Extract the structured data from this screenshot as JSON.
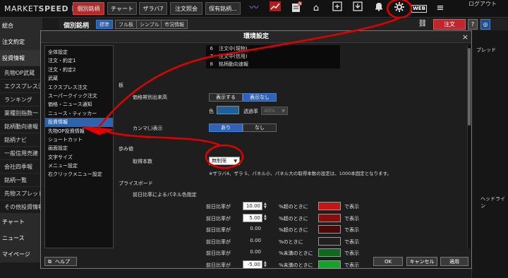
{
  "app": {
    "logo_left": "MARKET",
    "logo_right": "SPEED II",
    "logout_label": "ログアウト"
  },
  "topbar": {
    "buttons": [
      "個別銘柄",
      "チャート",
      "ザラバ7",
      "注文照会",
      "保有銘柄..."
    ],
    "web_label": "WEB",
    "badge_new": "N"
  },
  "leftnav": {
    "items": [
      "総合",
      "注文約定",
      "投資情報",
      "先物OP武蔵",
      "エクスプレス注文",
      "ランキング",
      "業種別指数一",
      "銘柄動向速報",
      "銘柄ナビ",
      "一般信用売建",
      "会社四季報",
      "銘柄一覧",
      "先物スプレッド機",
      "その他投資情報",
      "チャート",
      "ニュース",
      "マイページ"
    ]
  },
  "bgwindow": {
    "title": "個別銘柄",
    "tabs": [
      "標準",
      "フル板",
      "シンプル",
      "市況情報"
    ],
    "order_label": "注文",
    "help_label": "?",
    "side_label_1": "ブレッド",
    "side_label_2": "ヘッドライン"
  },
  "dialog": {
    "title": "環境設定",
    "close": "×",
    "menu": [
      "全体設定",
      "注文・約定1",
      "注文・約定2",
      "武蔵",
      "エクスプレス注文",
      "スーパークイック注文",
      "価格・ニュース通知",
      "ニュース・ティッカー",
      "投資情報",
      "先物OP投資情報",
      "ショートカット",
      "画面設定",
      "文字サイズ",
      "メニュー設定",
      "右クリックメニュー設定"
    ],
    "selected_index": 8,
    "list_rows": [
      {
        "no": "6",
        "text": "注文中(現物)"
      },
      {
        "no": "7",
        "text": "注文中(信用)"
      },
      {
        "no": "8",
        "text": "銘柄動向速報"
      }
    ],
    "board_section": "板",
    "price_volume_label": "価格帯別出来高",
    "show_label": "表示する",
    "hide_label": "表示なし",
    "color_label": "色",
    "color_value": "#1e5f9e",
    "opacity_label": "透過率",
    "opacity_value": "40%",
    "comma_label": "カンマ(,)表示",
    "comma_on": "あり",
    "comma_off": "なし",
    "ticks_section": "歩み値",
    "ticks_count_label": "取得本数",
    "ticks_count_value": "無制限",
    "ticks_note": "※ザラバ4、ザラ 5、パネル小、パネル大の取得本数の設定は、1000本固定となります。",
    "priceboard_section": "プライスボード",
    "panel_color_label": "前日比率によるパネル色指定",
    "ratio_label": "前日比率が",
    "display_suffix": "で表示",
    "rows": [
      {
        "value": "10.00",
        "editable": true,
        "cond": "%超のときに",
        "color": "#c41616"
      },
      {
        "value": "5.00",
        "editable": true,
        "cond": "%超のときに",
        "color": "#8a0e0e"
      },
      {
        "value": "0.00",
        "editable": false,
        "cond": "%超のときに",
        "color": "#4a0a0a"
      },
      {
        "value": "0.00",
        "editable": false,
        "cond": "%のときに",
        "color": "#202020"
      },
      {
        "value": "0.00",
        "editable": false,
        "cond": "%未満のときに",
        "color": "#0d6a1c"
      },
      {
        "value": "-5.00",
        "editable": true,
        "cond": "%未満のときに",
        "color": "#17a02a"
      }
    ],
    "help_label": "ヘルプ",
    "ok_label": "OK",
    "cancel_label": "キャンセル",
    "apply_label": "適用"
  },
  "annotation_color": "#e00000"
}
